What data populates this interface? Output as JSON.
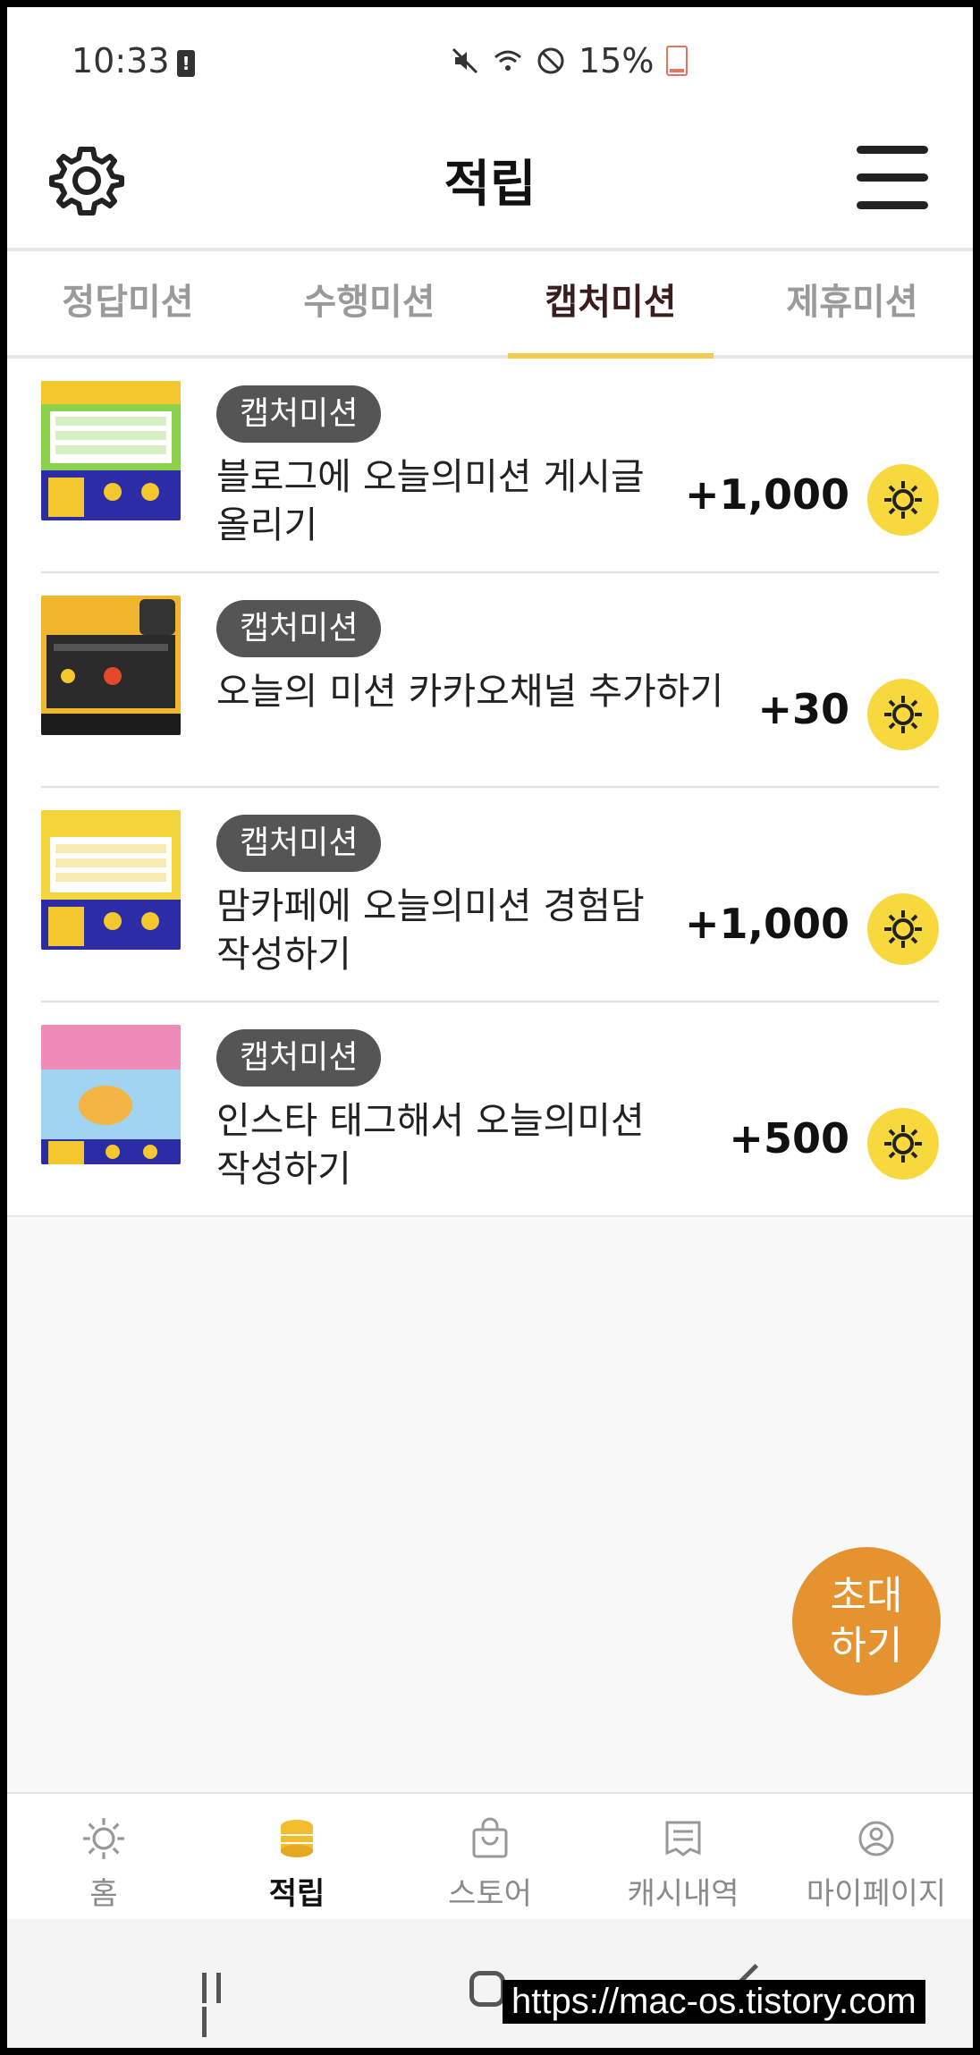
{
  "status_bar": {
    "time": "10:33",
    "battery": "15%"
  },
  "header": {
    "title": "적립"
  },
  "tabs": [
    "정답미션",
    "수행미션",
    "캡처미션",
    "제휴미션"
  ],
  "active_tab": "캡처미션",
  "missions": [
    {
      "badge": "캡처미션",
      "title": "블로그에 오늘의미션 게시글 올리기",
      "points": "+1,000"
    },
    {
      "badge": "캡처미션",
      "title": "오늘의 미션 카카오채널 추가하기",
      "points": "+30"
    },
    {
      "badge": "캡처미션",
      "title": "맘카페에 오늘의미션 경험담 작성하기",
      "points": "+1,000"
    },
    {
      "badge": "캡처미션",
      "title": "인스타 태그해서 오늘의미션 작성하기",
      "points": "+500"
    }
  ],
  "fab": {
    "line1": "초대",
    "line2": "하기"
  },
  "bottom_nav": [
    "홈",
    "적립",
    "스토어",
    "캐시내역",
    "마이페이지"
  ],
  "watermark": "https://mac-os.tistory.com",
  "colors": {
    "accent_yellow": "#f7d93d",
    "fab_orange": "#e59330",
    "tab_underline": "#f3cc4b"
  }
}
